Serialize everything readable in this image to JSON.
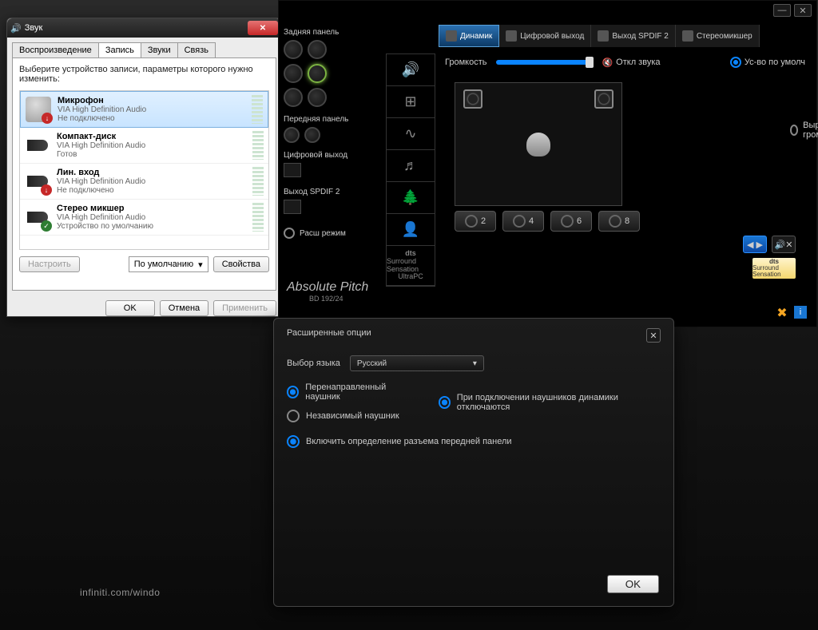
{
  "sound_dialog": {
    "title": "Звук",
    "tabs": [
      "Воспроизведение",
      "Запись",
      "Звуки",
      "Связь"
    ],
    "active_tab": 1,
    "instruction": "Выберите устройство записи, параметры которого нужно изменить:",
    "devices": [
      {
        "name": "Микрофон",
        "sub": "VIA High Definition Audio",
        "status": "Не подключено",
        "selected": true,
        "badge": "red"
      },
      {
        "name": "Компакт-диск",
        "sub": "VIA High Definition Audio",
        "status": "Готов",
        "selected": false
      },
      {
        "name": "Лин. вход",
        "sub": "VIA High Definition Audio",
        "status": "Не подключено",
        "selected": false,
        "badge": "red"
      },
      {
        "name": "Стерео микшер",
        "sub": "VIA High Definition Audio",
        "status": "Устройство по умолчанию",
        "selected": false,
        "badge": "green"
      }
    ],
    "configure": "Настроить",
    "default_label": "По умолчанию",
    "properties": "Свойства",
    "ok": "OK",
    "cancel": "Отмена",
    "apply": "Применить"
  },
  "audio_panel": {
    "left": {
      "rear_panel": "Задняя панель",
      "front_panel": "Передняя панель",
      "digital_out": "Цифровой выход",
      "spdif_out": "Выход SPDIF 2",
      "ext_mode": "Расш режим",
      "brand": "Absolute Pitch",
      "brand_sub": "BD 192/24"
    },
    "tabs": [
      {
        "label": "Динамик",
        "active": true
      },
      {
        "label": "Цифровой выход"
      },
      {
        "label": "Выход SPDIF 2"
      },
      {
        "label": "Стереомикшер"
      }
    ],
    "volume_label": "Громкость",
    "mute_label": "Откл звука",
    "default_device": "Ус-во по умолч",
    "normalize": "Выравнивание громкости",
    "speaker_counts": [
      "2",
      "4",
      "6",
      "8"
    ],
    "dts": "dts",
    "dts_sub1": "Surround Sensation",
    "dts_sub2": "UltraPC"
  },
  "adv_dialog": {
    "title": "Расширенные опции",
    "lang_label": "Выбор языка",
    "lang_value": "Русский",
    "opts": {
      "redirected_hp": "Перенаправленный наушник",
      "independent_hp": "Независимый наушник",
      "speakers_off_on_hp": "При подключении наушников динамики отключаются",
      "jack_detect": "Включить определение разъема передней панели"
    },
    "ok": "OK"
  },
  "desktop_brand": "infiniti.com/windo"
}
